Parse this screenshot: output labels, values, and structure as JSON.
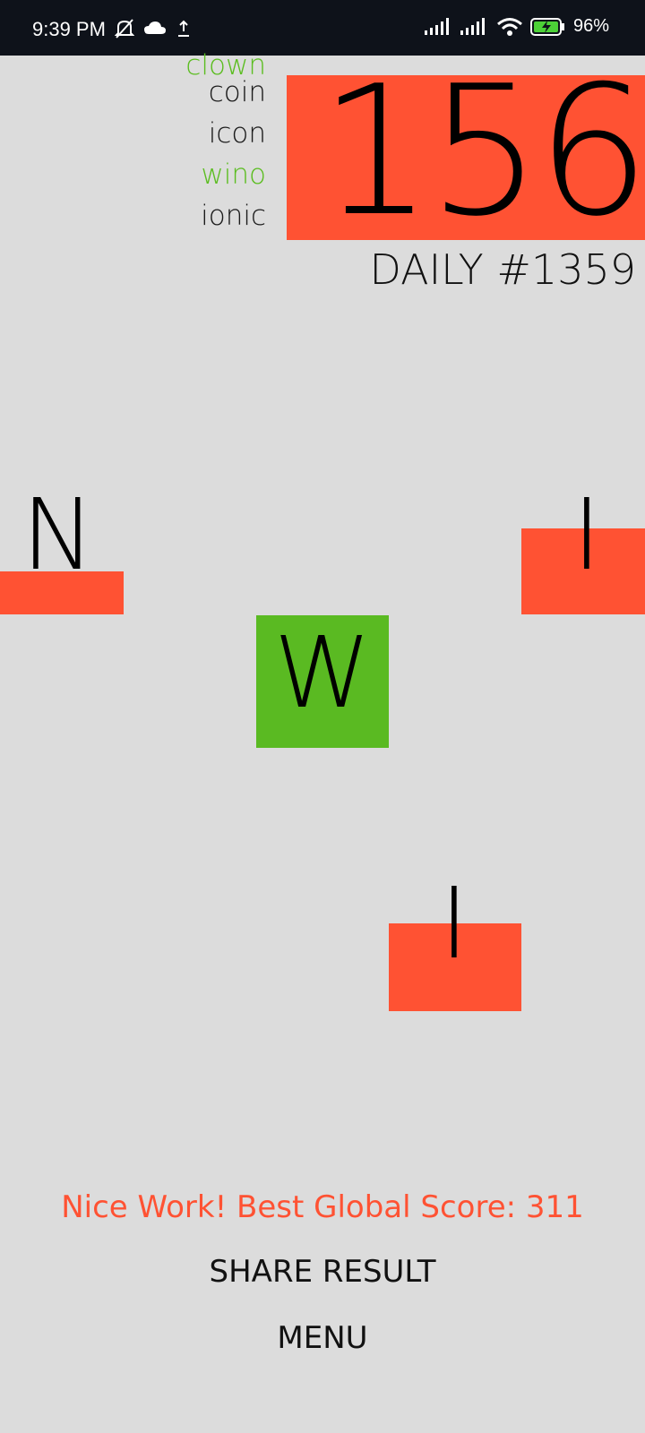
{
  "status_bar": {
    "time": "9:39 PM",
    "battery": "96%",
    "icons": [
      "bell-off-icon",
      "cloud-icon",
      "upload-icon",
      "signal-icon",
      "signal-icon",
      "wifi-icon",
      "battery-icon"
    ]
  },
  "words": [
    {
      "text": "clown",
      "found": true
    },
    {
      "text": "coin",
      "found": false
    },
    {
      "text": "icon",
      "found": false
    },
    {
      "text": "wino",
      "found": true
    },
    {
      "text": "ionic",
      "found": false
    }
  ],
  "score": "156",
  "daily_label": "DAILY #1359",
  "tiles": [
    {
      "letter": "N",
      "state": "red"
    },
    {
      "letter": "I",
      "state": "red"
    },
    {
      "letter": "W",
      "state": "green"
    },
    {
      "letter": "I",
      "state": "red"
    }
  ],
  "message": "Nice Work! Best Global Score: 311",
  "share_label": "SHARE RESULT",
  "menu_label": "MENU",
  "colors": {
    "accent_red": "#ff5233",
    "accent_green": "#5aba22",
    "background": "#dcdcdc"
  }
}
